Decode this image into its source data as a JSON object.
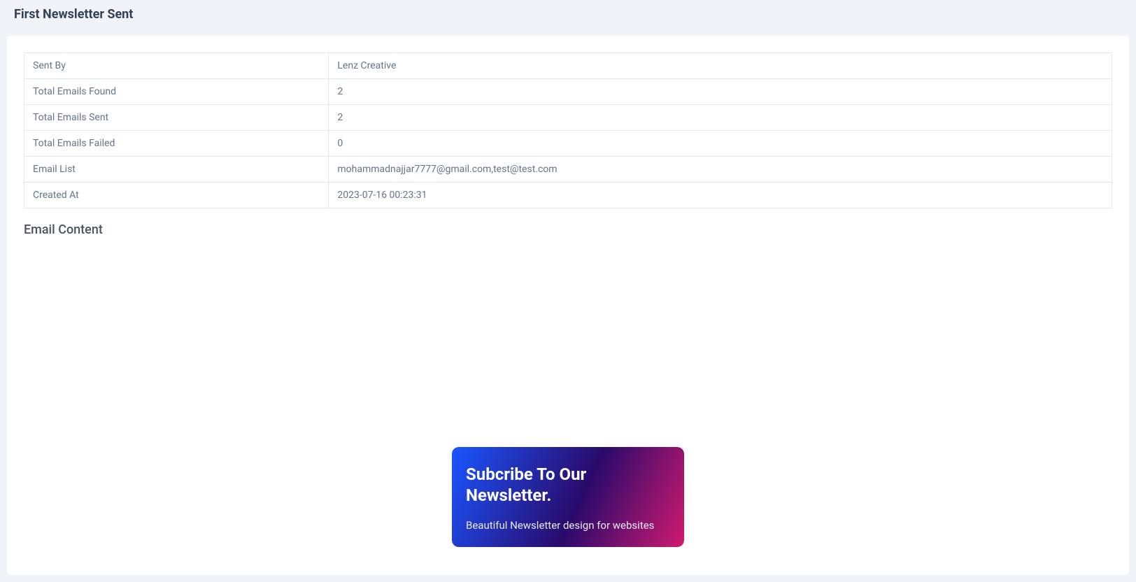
{
  "header": {
    "title": "First Newsletter Sent"
  },
  "details": {
    "rows": [
      {
        "label": "Sent By",
        "value": "Lenz Creative"
      },
      {
        "label": "Total Emails Found",
        "value": "2"
      },
      {
        "label": "Total Emails Sent",
        "value": "2"
      },
      {
        "label": "Total Emails Failed",
        "value": "0"
      },
      {
        "label": "Email List",
        "value": "mohammadnajjar7777@gmail.com,test@test.com"
      },
      {
        "label": "Created At",
        "value": "2023-07-16 00:23:31"
      }
    ]
  },
  "section": {
    "email_content_heading": "Email Content"
  },
  "newsletter_preview": {
    "title": "Subcribe To Our Newsletter.",
    "subtitle": "Beautiful Newsletter design for websites"
  }
}
